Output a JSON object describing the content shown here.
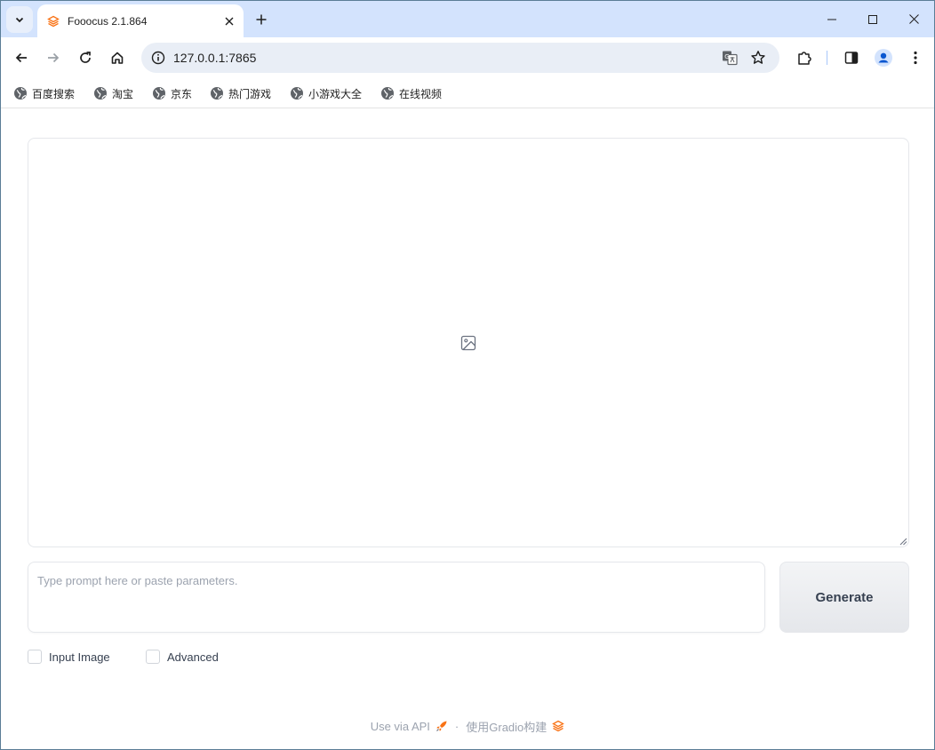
{
  "browser": {
    "tab_title": "Fooocus 2.1.864",
    "url": "127.0.0.1:7865",
    "bookmarks": [
      {
        "label": "百度搜索"
      },
      {
        "label": "淘宝"
      },
      {
        "label": "京东"
      },
      {
        "label": "热门游戏"
      },
      {
        "label": "小游戏大全"
      },
      {
        "label": "在线视频"
      }
    ]
  },
  "app": {
    "prompt_placeholder": "Type prompt here or paste parameters.",
    "prompt_value": "",
    "generate_label": "Generate",
    "checkboxes": [
      {
        "label": "Input Image",
        "checked": false
      },
      {
        "label": "Advanced",
        "checked": false
      }
    ],
    "footer": {
      "api_label": "Use via API",
      "separator": "·",
      "built_with_label": "使用Gradio构建"
    }
  },
  "colors": {
    "tabstrip": "#d3e3fd",
    "omnibox": "#e9eef6",
    "gradio_orange": "#f97316"
  },
  "icons": {
    "favicon": "gradio-logo-icon",
    "gallery_placeholder": "image-icon",
    "api": "rocket-icon",
    "built_with": "gradio-logo-icon"
  }
}
